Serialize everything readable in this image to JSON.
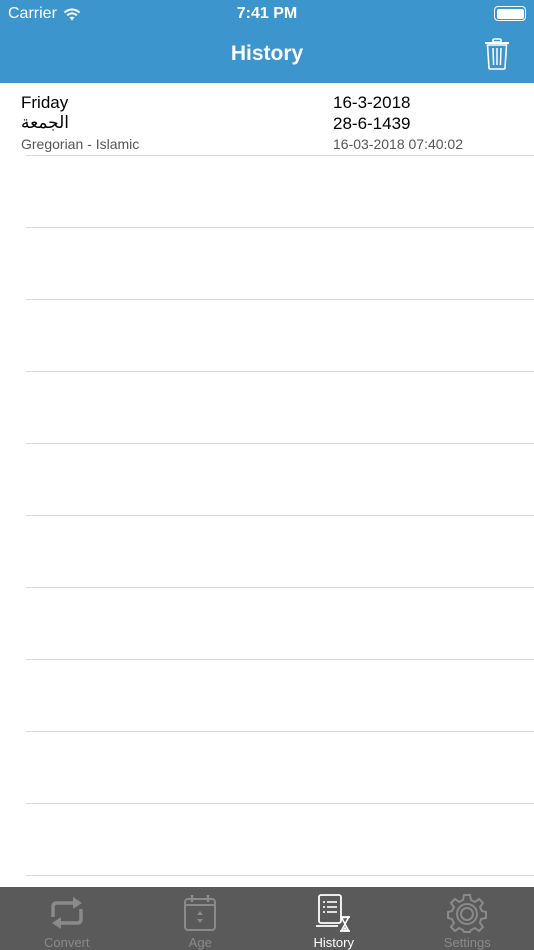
{
  "status": {
    "carrier": "Carrier",
    "time": "7:41 PM"
  },
  "navbar": {
    "title": "History",
    "trash_icon": "trash-icon"
  },
  "history": [
    {
      "day": "Friday",
      "arabic_day": "الجمعة",
      "conversion_type": "Gregorian - Islamic",
      "gregorian_date": "16-3-2018",
      "islamic_date": "28-6-1439",
      "timestamp": "16-03-2018 07:40:02"
    }
  ],
  "tabs": [
    {
      "label": "Convert",
      "icon": "convert-arrows-icon",
      "active": false
    },
    {
      "label": "Age",
      "icon": "calendar-icon",
      "active": false
    },
    {
      "label": "History",
      "icon": "history-list-hourglass-icon",
      "active": true
    },
    {
      "label": "Settings",
      "icon": "gear-icon",
      "active": false
    }
  ],
  "colors": {
    "navbar": "#3d95cd",
    "tabbar": "#5a5a5a",
    "tab_active": "#ffffff",
    "tab_inactive": "#8a8a8a"
  }
}
